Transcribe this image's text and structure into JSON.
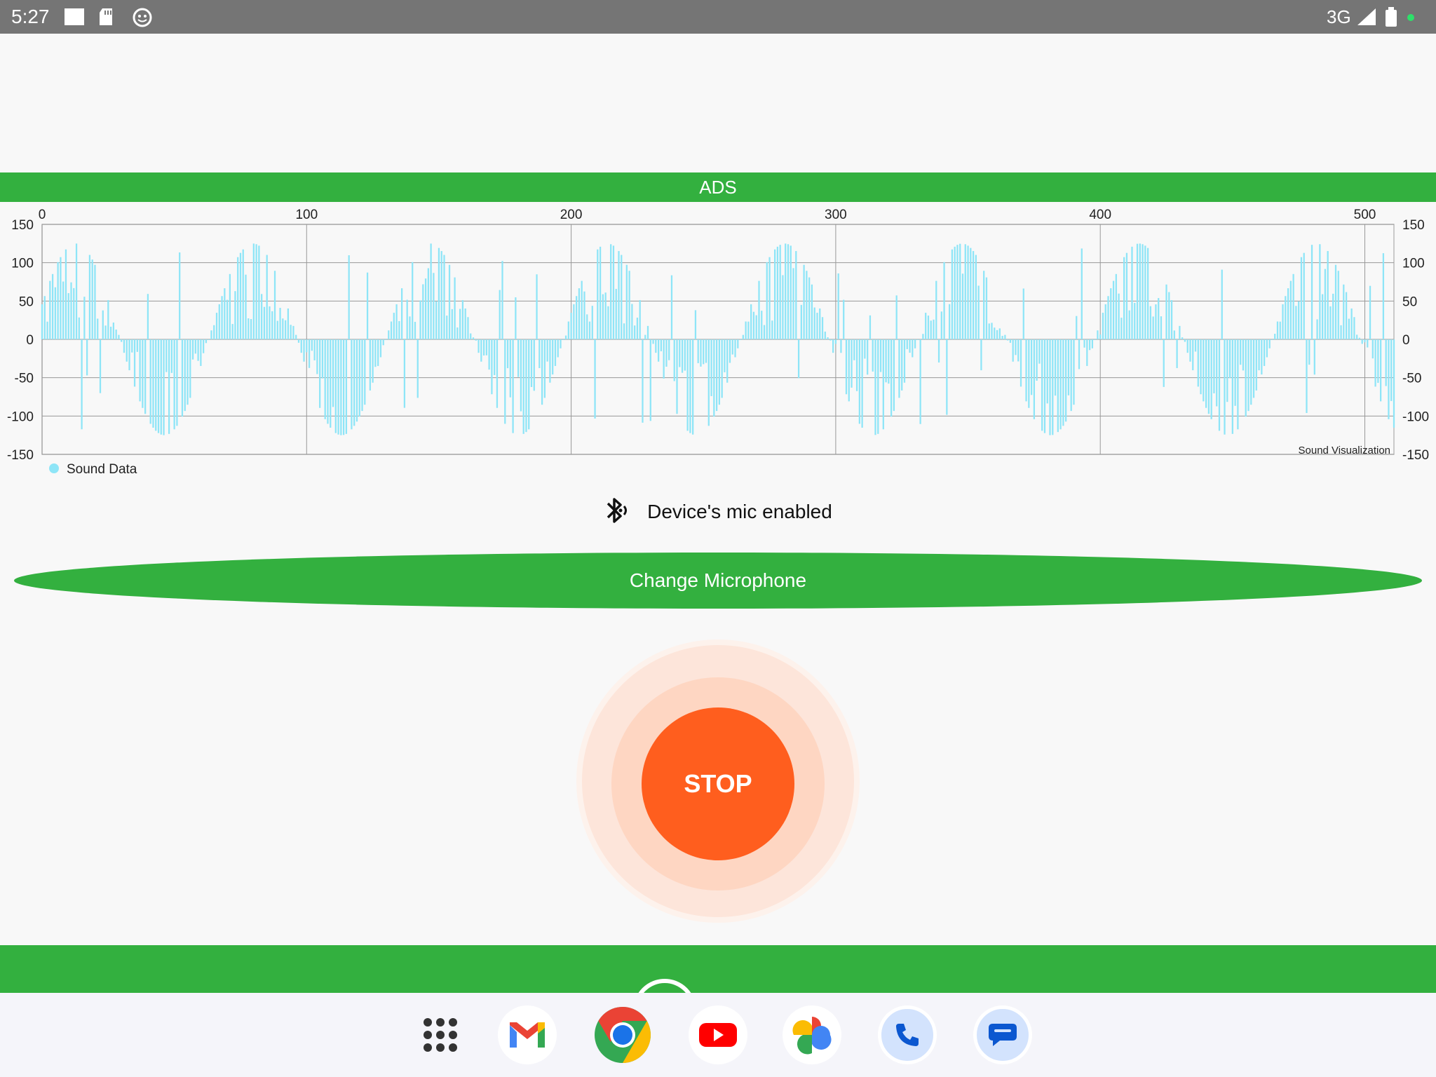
{
  "status_bar": {
    "time": "5:27",
    "network": "3G",
    "icons": [
      "notification-square-icon",
      "sd-card-icon",
      "face-icon",
      "signal-icon",
      "battery-icon",
      "green-dot-icon"
    ]
  },
  "ad_banner": {
    "label": "ADS"
  },
  "chart_data": {
    "type": "bar",
    "title": "",
    "description_label": "Sound Visualization",
    "xlim": [
      0,
      511
    ],
    "ylim": [
      -150,
      150
    ],
    "x_ticks": [
      "0",
      "100",
      "200",
      "300",
      "400",
      "500"
    ],
    "y_ticks": [
      "150",
      "100",
      "50",
      "0",
      "-50",
      "-100",
      "-150"
    ],
    "grid": true,
    "legend_position": "bottom-left",
    "series": [
      {
        "name": "Sound Data",
        "color": "#8ee5f7",
        "amplitude": 125,
        "period_samples": 67,
        "n_samples": 512
      }
    ]
  },
  "mic_status": {
    "text": "Device's mic enabled",
    "icon": "bluetooth-audio-icon"
  },
  "change_mic_button": {
    "label": "Change Microphone"
  },
  "stop_button": {
    "label": "STOP"
  },
  "dock": {
    "apps": [
      "app-drawer-icon",
      "gmail-icon",
      "chrome-icon",
      "youtube-icon",
      "photos-icon",
      "phone-icon",
      "messages-icon"
    ]
  },
  "colors": {
    "accent_green": "#33b03f",
    "stop_orange": "#ff5e1e",
    "wave_cyan": "#8ee5f7"
  }
}
